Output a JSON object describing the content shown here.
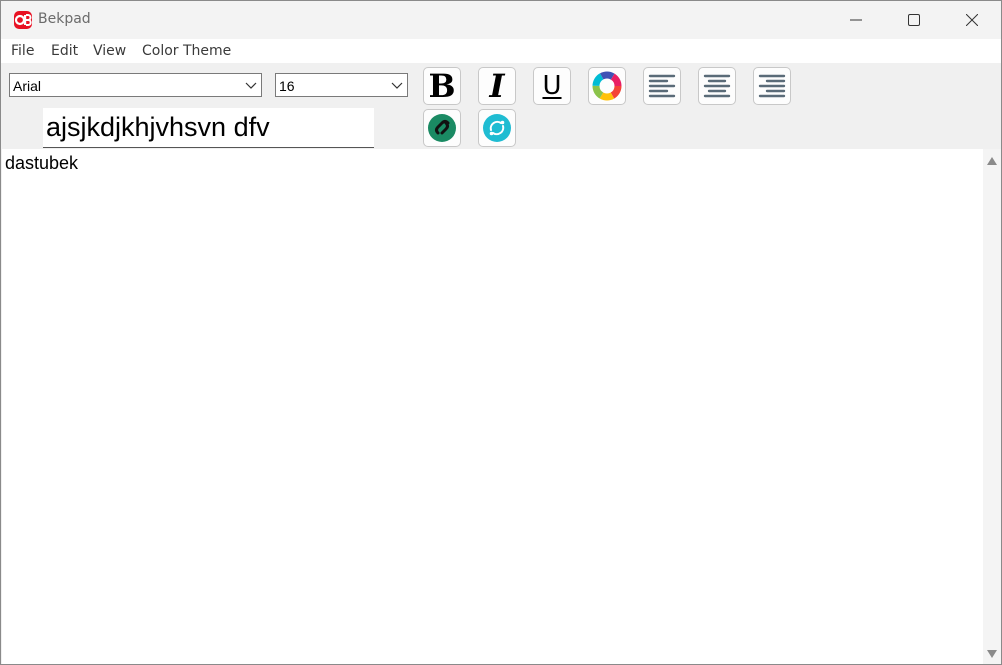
{
  "window": {
    "title": "Bekpad",
    "controls": {
      "minimize": "minimize-icon",
      "maximize": "maximize-icon",
      "close": "close-icon"
    }
  },
  "menu": {
    "items": [
      "File",
      "Edit",
      "View",
      "Color Theme"
    ]
  },
  "toolbar": {
    "font_family": "Arial",
    "font_size": "16",
    "preview_text": "ajsjkdjkhjvhsvn dfv",
    "buttons": {
      "bold": "B",
      "italic": "I",
      "underline": "U"
    },
    "icons": [
      "color-wheel-icon",
      "align-left-icon",
      "align-center-icon",
      "align-right-icon",
      "link-icon",
      "sync-icon"
    ],
    "colors": {
      "accent_red": "#e81123",
      "link_green": "#1a8a63",
      "sync_teal": "#1fbcd2"
    }
  },
  "editor": {
    "content": "dastubek"
  }
}
